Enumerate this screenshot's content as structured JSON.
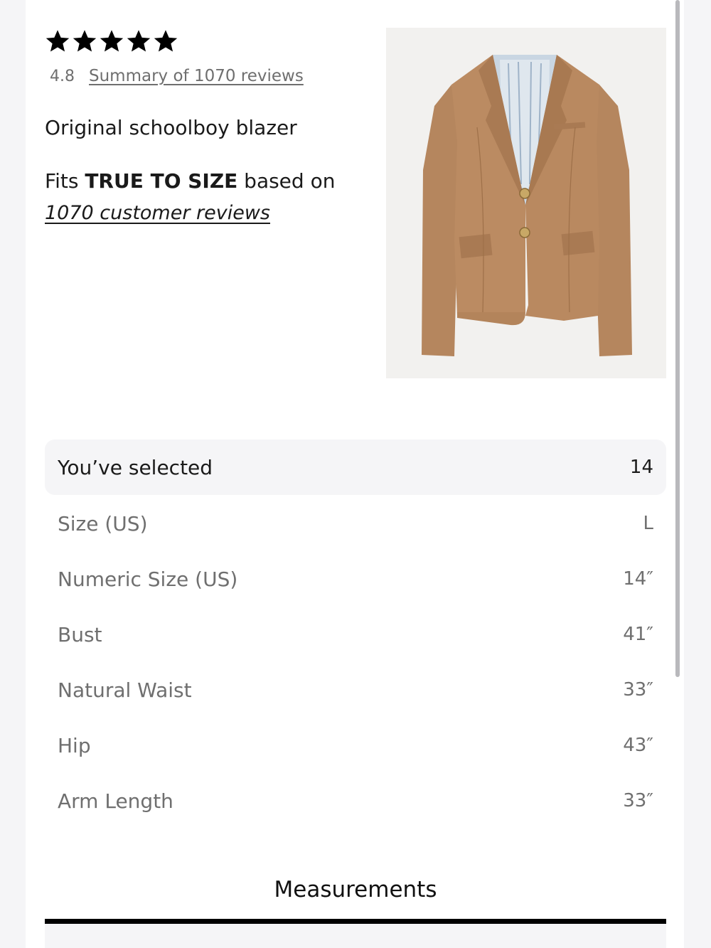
{
  "rating": {
    "stars": 5,
    "value": "4.8",
    "summary_link": "Summary of 1070 reviews"
  },
  "product": {
    "name": "Original schoolboy blazer",
    "image_icon": "blazer-image"
  },
  "fit": {
    "prefix": "Fits ",
    "emphasis": "TRUE TO SIZE",
    "suffix": " based on",
    "reviews_link": "1070 customer reviews"
  },
  "selected": {
    "label": "You’ve selected",
    "value": "14"
  },
  "size_rows": [
    {
      "label": "Size (US)",
      "value": "L"
    },
    {
      "label": "Numeric Size (US)",
      "value": "14″"
    },
    {
      "label": "Bust",
      "value": "41″"
    },
    {
      "label": "Natural Waist",
      "value": "33″"
    },
    {
      "label": "Hip",
      "value": "43″"
    },
    {
      "label": "Arm Length",
      "value": "33″"
    }
  ],
  "tabs": {
    "active": "Measurements"
  },
  "colors": {
    "text": "#1a1a1a",
    "muted": "#6f6f6f",
    "row_bg": "#f5f5f7",
    "blazer": "#b5865e"
  }
}
